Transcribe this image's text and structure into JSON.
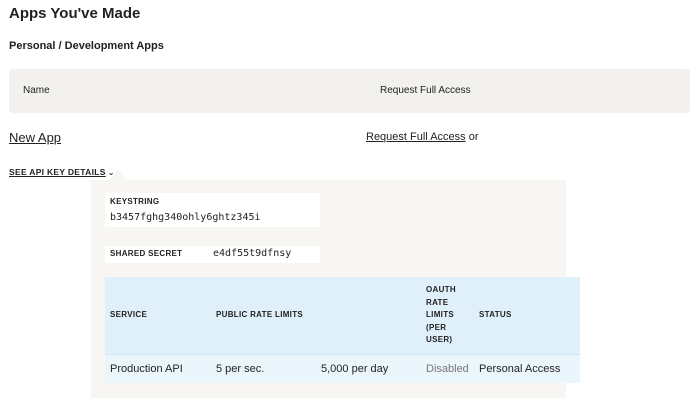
{
  "page": {
    "title": "Apps You've Made",
    "section": "Personal / Development Apps"
  },
  "apps_table": {
    "columns": [
      "Name",
      "Request Full Access"
    ]
  },
  "actions": {
    "new_app": "New App",
    "request_full_access": "Request Full Access",
    "or_text": "or"
  },
  "api_details": {
    "toggle_label": "SEE API KEY DETAILS",
    "toggle_icon": "chevron-down-icon",
    "keystring_label": "KEYSTRING",
    "keystring_value": "b3457fghg340ohly6ghtz345i",
    "shared_secret_label": "SHARED SECRET",
    "shared_secret_value": "e4df55t9dfnsy"
  },
  "service_table": {
    "headers": {
      "service": "SERVICE",
      "public_rate_limits": "PUBLIC RATE LIMITS",
      "oauth_rate_limits": "OAUTH RATE LIMITS (PER USER)",
      "status": "STATUS"
    },
    "rows": [
      {
        "service": "Production API",
        "rate_per_sec": "5 per sec.",
        "rate_per_day": "5,000 per day",
        "oauth": "Disabled",
        "status": "Personal Access"
      }
    ]
  },
  "colors": {
    "header_bg": "#f2f1ed",
    "panel_bg": "#f7f6f2",
    "table_head_bg": "#dff0fa",
    "table_row_bg": "#ebf6fc",
    "muted_text": "#777777"
  }
}
